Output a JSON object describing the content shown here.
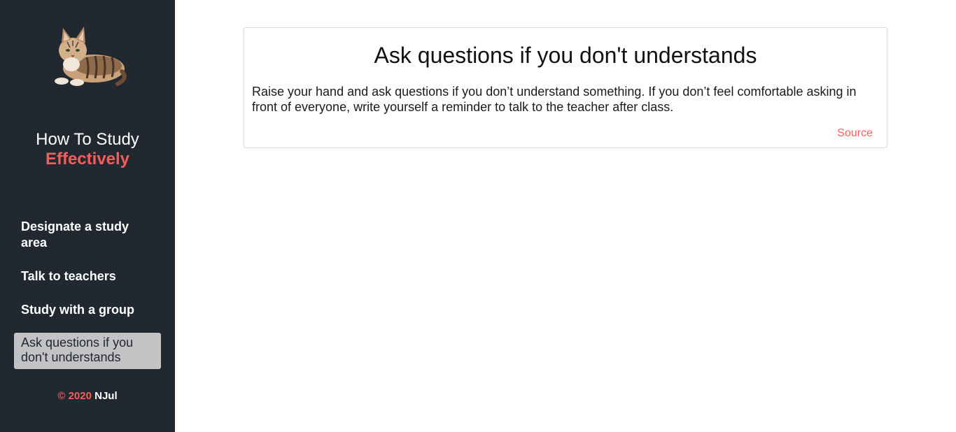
{
  "sidebar": {
    "logo_icon": "cat-logo-icon",
    "brand_line1": "How To Study",
    "brand_line2": "Effectively",
    "nav": [
      {
        "label": "Designate a study area",
        "active": false
      },
      {
        "label": "Talk to teachers",
        "active": false
      },
      {
        "label": "Study with a group",
        "active": false
      },
      {
        "label": "Ask questions if you don't understands",
        "active": true
      }
    ],
    "footer_copyright": "© 2020",
    "footer_author": "NJul"
  },
  "main": {
    "card": {
      "title": "Ask questions if you don't understands",
      "body": "Raise your hand and ask questions if you don’t understand something. If you don’t feel comfortable asking in front of everyone, write yourself a reminder to talk to the teacher after class.",
      "source_label": "Source"
    }
  },
  "colors": {
    "sidebar_bg": "#212830",
    "accent": "#f25f5c",
    "active_nav_bg": "#c3c3c5",
    "card_border": "#dcdcdc"
  }
}
